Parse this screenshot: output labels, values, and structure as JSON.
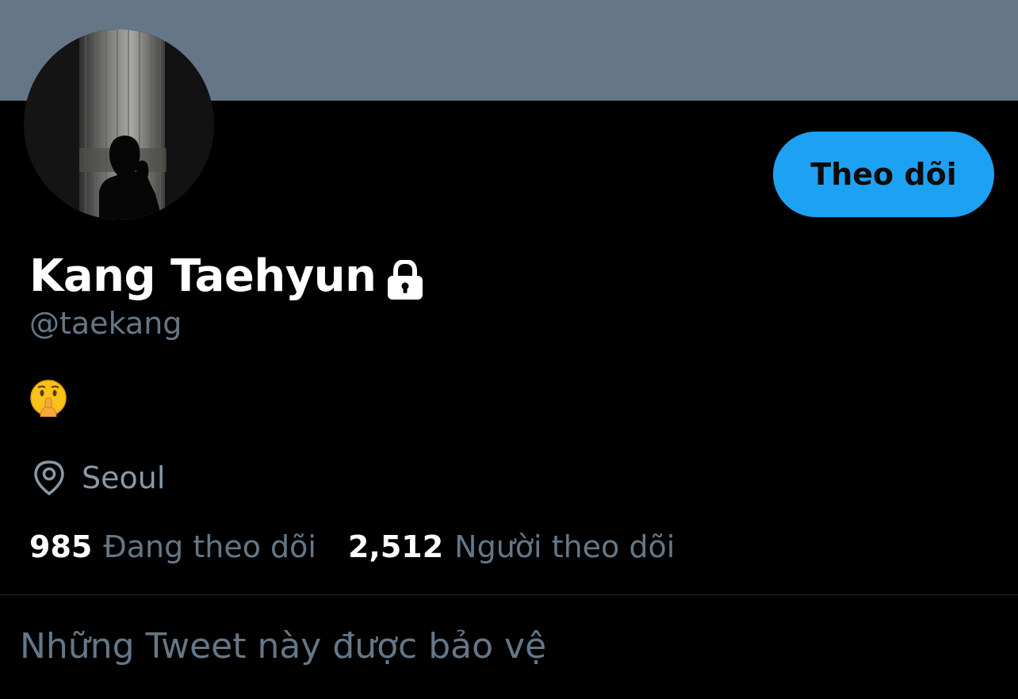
{
  "colors": {
    "background": "#000000",
    "banner": "#657786",
    "accent": "#1DA1F2",
    "secondary_text": "#657786",
    "primary_text": "#ffffff"
  },
  "profile": {
    "display_name": "Kang Taehyun",
    "handle": "@taekang",
    "protected_icon": "lock-icon",
    "avatar_icon": "avatar-photo",
    "bio_emoji": "🤫",
    "bio_emoji_icon": "shushing-face-emoji",
    "location_icon": "location-pin-icon",
    "location": "Seoul"
  },
  "actions": {
    "follow_label": "Theo dõi"
  },
  "stats": {
    "following_count": "985",
    "following_label": "Đang theo dõi",
    "followers_count": "2,512",
    "followers_label": "Người theo dõi"
  },
  "protected_notice": {
    "text": "Những Tweet này được bảo vệ"
  }
}
